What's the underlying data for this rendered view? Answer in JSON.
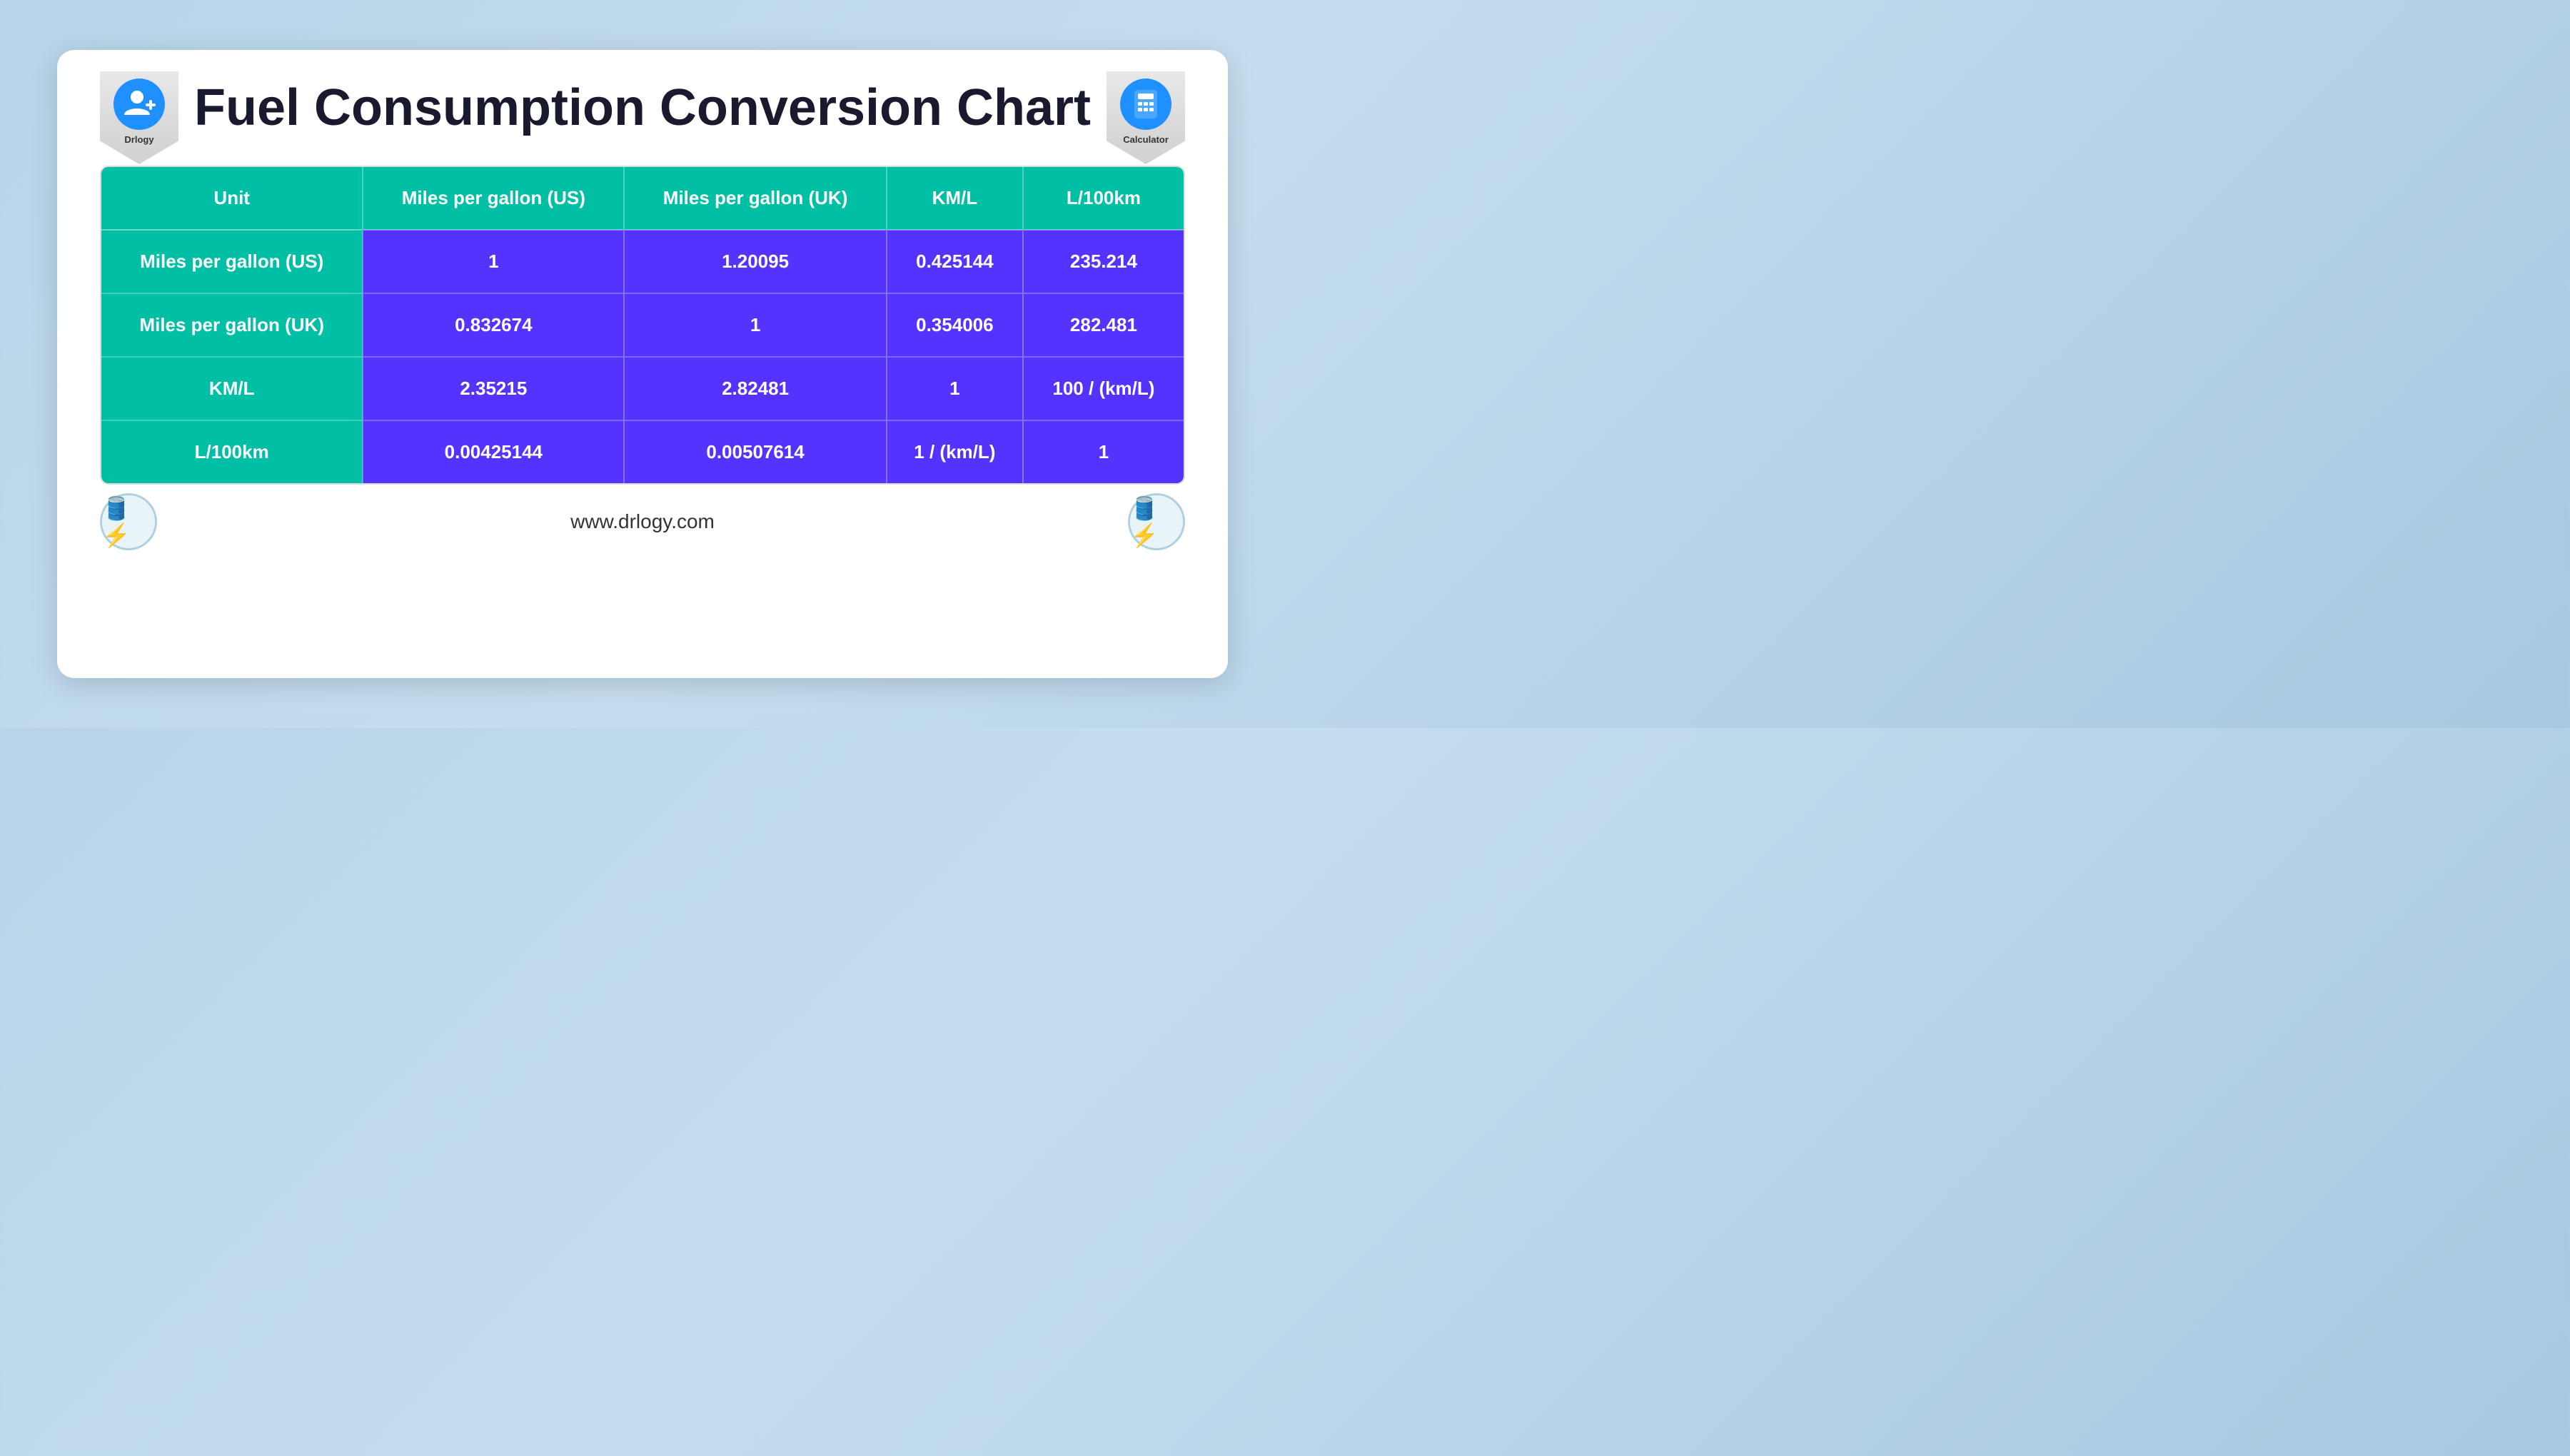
{
  "page": {
    "title": "Fuel Consumption Conversion Chart",
    "footer_url": "www.drlogy.com"
  },
  "logos": {
    "left_label": "Drlogy",
    "right_label": "Calculator"
  },
  "table": {
    "headers": [
      "Unit",
      "Miles per gallon (US)",
      "Miles per gallon (UK)",
      "KM/L",
      "L/100km"
    ],
    "rows": [
      {
        "unit": "Miles per gallon (US)",
        "mpg_us": "1",
        "mpg_uk": "1.20095",
        "kml": "0.425144",
        "l100km": "235.214"
      },
      {
        "unit": "Miles per gallon (UK)",
        "mpg_us": "0.832674",
        "mpg_uk": "1",
        "kml": "0.354006",
        "l100km": "282.481"
      },
      {
        "unit": "KM/L",
        "mpg_us": "2.35215",
        "mpg_uk": "2.82481",
        "kml": "1",
        "l100km": "100 / (km/L)"
      },
      {
        "unit": "L/100km",
        "mpg_us": "0.00425144",
        "mpg_uk": "0.00507614",
        "kml": "1 / (km/L)",
        "l100km": "1"
      }
    ]
  }
}
